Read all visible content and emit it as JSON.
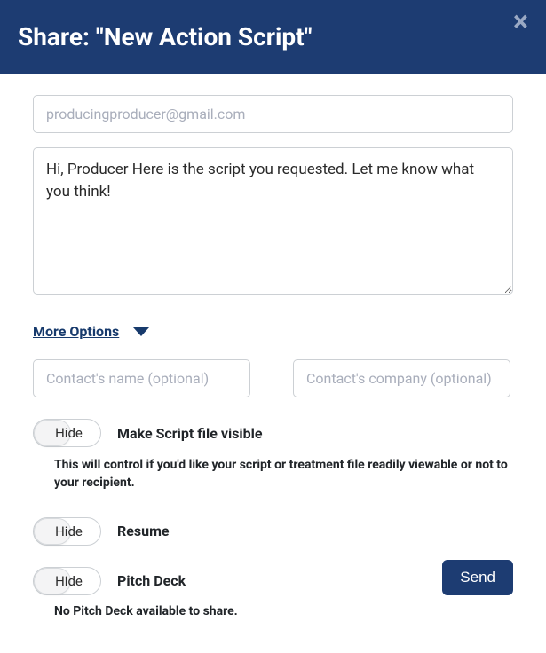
{
  "header": {
    "title": "Share: \"New Action Script\""
  },
  "email": {
    "placeholder": "producingproducer@gmail.com",
    "value": ""
  },
  "message": {
    "value": "Hi, Producer Here is the script you requested. Let me know what you think!"
  },
  "more_options": {
    "label": "More Options"
  },
  "contact": {
    "name_placeholder": "Contact's name (optional)",
    "company_placeholder": "Contact's company (optional)"
  },
  "options": {
    "script": {
      "toggle": "Hide",
      "label": "Make Script file visible",
      "desc": "This will control if you'd like your script or treatment file readily viewable or not to your recipient."
    },
    "resume": {
      "toggle": "Hide",
      "label": "Resume"
    },
    "pitchdeck": {
      "toggle": "Hide",
      "label": "Pitch Deck",
      "note": "No Pitch Deck available to share."
    }
  },
  "send": {
    "label": "Send"
  }
}
